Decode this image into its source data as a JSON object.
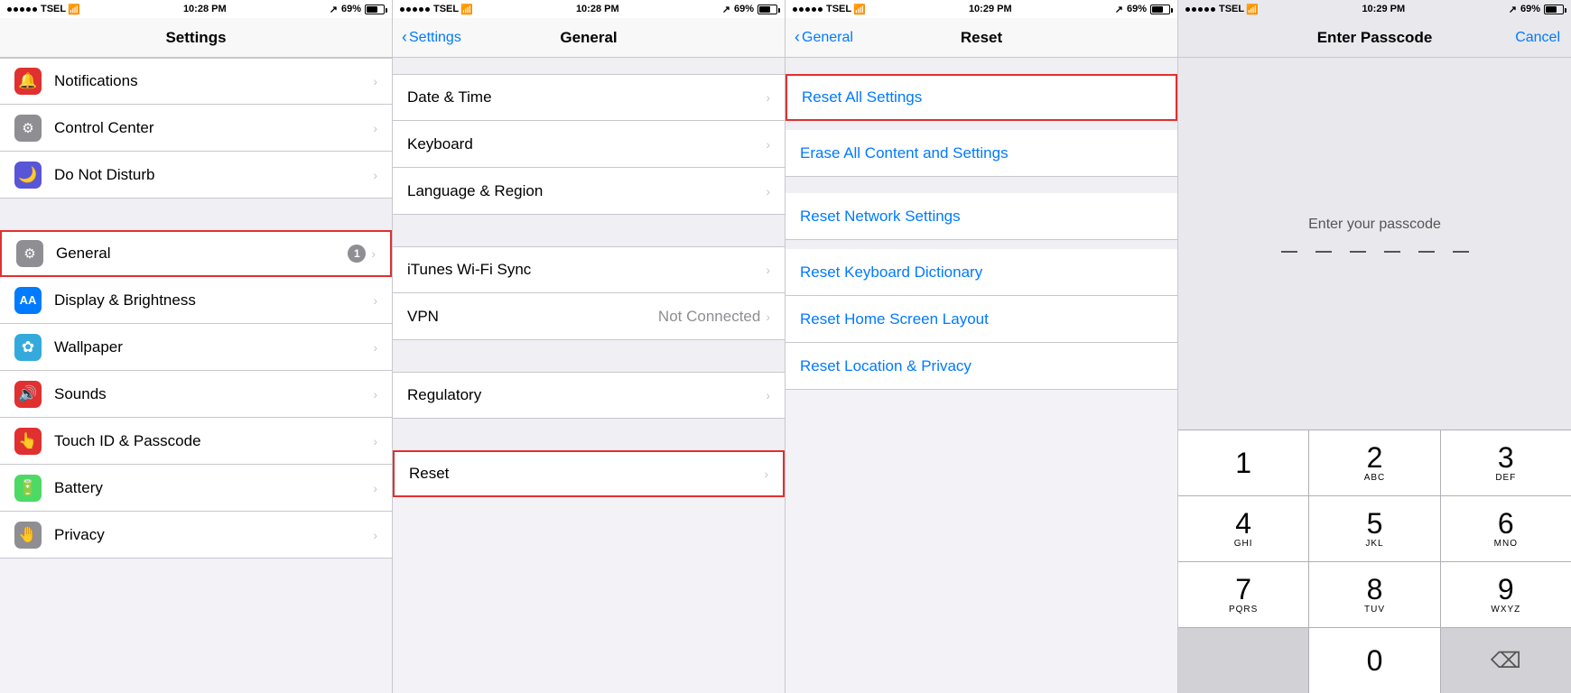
{
  "panels": [
    {
      "id": "settings",
      "statusBar": {
        "carrier": "TSEL",
        "time": "10:28 PM",
        "signal": "↗",
        "battery": "69%"
      },
      "navTitle": "Settings",
      "navBack": null,
      "sections": [
        {
          "items": [
            {
              "id": "notifications",
              "icon": "🔔",
              "iconBg": "#e03030",
              "label": "Notifications",
              "value": "",
              "badge": null,
              "chevron": true
            },
            {
              "id": "control-center",
              "icon": "⚙",
              "iconBg": "#8e8e93",
              "label": "Control Center",
              "value": "",
              "badge": null,
              "chevron": true
            },
            {
              "id": "do-not-disturb",
              "icon": "🌙",
              "iconBg": "#5856d6",
              "label": "Do Not Disturb",
              "value": "",
              "badge": null,
              "chevron": true
            }
          ]
        },
        {
          "separator": true,
          "items": [
            {
              "id": "general",
              "icon": "⚙",
              "iconBg": "#8e8e93",
              "label": "General",
              "value": "",
              "badge": "1",
              "chevron": true,
              "highlighted": true
            },
            {
              "id": "display-brightness",
              "icon": "AA",
              "iconBg": "#007aff",
              "label": "Display & Brightness",
              "value": "",
              "badge": null,
              "chevron": true
            },
            {
              "id": "wallpaper",
              "icon": "✿",
              "iconBg": "#34aadc",
              "label": "Wallpaper",
              "value": "",
              "badge": null,
              "chevron": true
            },
            {
              "id": "sounds",
              "icon": "🔊",
              "iconBg": "#e03030",
              "label": "Sounds",
              "value": "",
              "badge": null,
              "chevron": true
            },
            {
              "id": "touch-id",
              "icon": "👆",
              "iconBg": "#e03030",
              "label": "Touch ID & Passcode",
              "value": "",
              "badge": null,
              "chevron": true
            },
            {
              "id": "battery",
              "icon": "🔋",
              "iconBg": "#4cd964",
              "label": "Battery",
              "value": "",
              "badge": null,
              "chevron": true
            },
            {
              "id": "privacy",
              "icon": "🤚",
              "iconBg": "#8e8e93",
              "label": "Privacy",
              "value": "",
              "badge": null,
              "chevron": true
            }
          ]
        }
      ]
    },
    {
      "id": "general",
      "statusBar": {
        "carrier": "TSEL",
        "time": "10:28 PM",
        "signal": "↗",
        "battery": "69%"
      },
      "navTitle": "General",
      "navBack": "Settings",
      "sections": [
        {
          "items": [
            {
              "id": "date-time",
              "label": "Date & Time",
              "value": "",
              "chevron": true
            },
            {
              "id": "keyboard",
              "label": "Keyboard",
              "value": "",
              "chevron": true
            },
            {
              "id": "language-region",
              "label": "Language & Region",
              "value": "",
              "chevron": true
            }
          ]
        },
        {
          "separator": true,
          "items": [
            {
              "id": "itunes-wifi",
              "label": "iTunes Wi-Fi Sync",
              "value": "",
              "chevron": true
            },
            {
              "id": "vpn",
              "label": "VPN",
              "value": "Not Connected",
              "chevron": true
            }
          ]
        },
        {
          "separator": true,
          "items": [
            {
              "id": "regulatory",
              "label": "Regulatory",
              "value": "",
              "chevron": true
            }
          ]
        },
        {
          "separator": true,
          "items": [
            {
              "id": "reset",
              "label": "Reset",
              "value": "",
              "chevron": true,
              "highlighted": true
            }
          ]
        }
      ]
    },
    {
      "id": "reset",
      "statusBar": {
        "carrier": "TSEL",
        "time": "10:29 PM",
        "signal": "↗",
        "battery": "69%"
      },
      "navTitle": "Reset",
      "navBack": "General",
      "items": [
        {
          "id": "reset-all-settings",
          "label": "Reset All Settings",
          "highlighted": true
        },
        {
          "id": "erase-all",
          "label": "Erase All Content and Settings"
        },
        {
          "id": "reset-network",
          "label": "Reset Network Settings"
        },
        {
          "id": "reset-keyboard",
          "label": "Reset Keyboard Dictionary"
        },
        {
          "id": "reset-home-screen",
          "label": "Reset Home Screen Layout"
        },
        {
          "id": "reset-location",
          "label": "Reset Location & Privacy"
        }
      ]
    },
    {
      "id": "passcode",
      "statusBar": {
        "carrier": "TSEL",
        "time": "10:29 PM",
        "signal": "↗",
        "battery": "69%"
      },
      "navTitle": "Enter Passcode",
      "navAction": "Cancel",
      "prompt": "Enter your passcode",
      "keypad": [
        [
          {
            "number": "1",
            "letters": ""
          },
          {
            "number": "2",
            "letters": "ABC"
          },
          {
            "number": "3",
            "letters": "DEF"
          }
        ],
        [
          {
            "number": "4",
            "letters": "GHI"
          },
          {
            "number": "5",
            "letters": "JKL"
          },
          {
            "number": "6",
            "letters": "MNO"
          }
        ],
        [
          {
            "number": "7",
            "letters": "PQRS"
          },
          {
            "number": "8",
            "letters": "TUV"
          },
          {
            "number": "9",
            "letters": "WXYZ"
          }
        ],
        [
          {
            "number": "",
            "letters": "",
            "empty": true
          },
          {
            "number": "0",
            "letters": ""
          },
          {
            "number": "⌫",
            "letters": "",
            "delete": true
          }
        ]
      ]
    }
  ]
}
